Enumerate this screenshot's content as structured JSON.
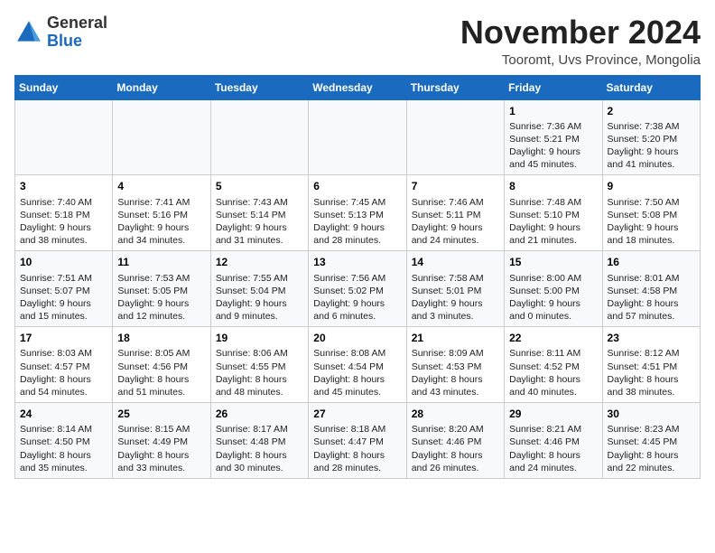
{
  "logo": {
    "text_general": "General",
    "text_blue": "Blue"
  },
  "header": {
    "month_title": "November 2024",
    "location": "Tooromt, Uvs Province, Mongolia"
  },
  "columns": [
    "Sunday",
    "Monday",
    "Tuesday",
    "Wednesday",
    "Thursday",
    "Friday",
    "Saturday"
  ],
  "weeks": [
    [
      {
        "day": "",
        "sunrise": "",
        "sunset": "",
        "daylight": ""
      },
      {
        "day": "",
        "sunrise": "",
        "sunset": "",
        "daylight": ""
      },
      {
        "day": "",
        "sunrise": "",
        "sunset": "",
        "daylight": ""
      },
      {
        "day": "",
        "sunrise": "",
        "sunset": "",
        "daylight": ""
      },
      {
        "day": "",
        "sunrise": "",
        "sunset": "",
        "daylight": ""
      },
      {
        "day": "1",
        "sunrise": "Sunrise: 7:36 AM",
        "sunset": "Sunset: 5:21 PM",
        "daylight": "Daylight: 9 hours and 45 minutes."
      },
      {
        "day": "2",
        "sunrise": "Sunrise: 7:38 AM",
        "sunset": "Sunset: 5:20 PM",
        "daylight": "Daylight: 9 hours and 41 minutes."
      }
    ],
    [
      {
        "day": "3",
        "sunrise": "Sunrise: 7:40 AM",
        "sunset": "Sunset: 5:18 PM",
        "daylight": "Daylight: 9 hours and 38 minutes."
      },
      {
        "day": "4",
        "sunrise": "Sunrise: 7:41 AM",
        "sunset": "Sunset: 5:16 PM",
        "daylight": "Daylight: 9 hours and 34 minutes."
      },
      {
        "day": "5",
        "sunrise": "Sunrise: 7:43 AM",
        "sunset": "Sunset: 5:14 PM",
        "daylight": "Daylight: 9 hours and 31 minutes."
      },
      {
        "day": "6",
        "sunrise": "Sunrise: 7:45 AM",
        "sunset": "Sunset: 5:13 PM",
        "daylight": "Daylight: 9 hours and 28 minutes."
      },
      {
        "day": "7",
        "sunrise": "Sunrise: 7:46 AM",
        "sunset": "Sunset: 5:11 PM",
        "daylight": "Daylight: 9 hours and 24 minutes."
      },
      {
        "day": "8",
        "sunrise": "Sunrise: 7:48 AM",
        "sunset": "Sunset: 5:10 PM",
        "daylight": "Daylight: 9 hours and 21 minutes."
      },
      {
        "day": "9",
        "sunrise": "Sunrise: 7:50 AM",
        "sunset": "Sunset: 5:08 PM",
        "daylight": "Daylight: 9 hours and 18 minutes."
      }
    ],
    [
      {
        "day": "10",
        "sunrise": "Sunrise: 7:51 AM",
        "sunset": "Sunset: 5:07 PM",
        "daylight": "Daylight: 9 hours and 15 minutes."
      },
      {
        "day": "11",
        "sunrise": "Sunrise: 7:53 AM",
        "sunset": "Sunset: 5:05 PM",
        "daylight": "Daylight: 9 hours and 12 minutes."
      },
      {
        "day": "12",
        "sunrise": "Sunrise: 7:55 AM",
        "sunset": "Sunset: 5:04 PM",
        "daylight": "Daylight: 9 hours and 9 minutes."
      },
      {
        "day": "13",
        "sunrise": "Sunrise: 7:56 AM",
        "sunset": "Sunset: 5:02 PM",
        "daylight": "Daylight: 9 hours and 6 minutes."
      },
      {
        "day": "14",
        "sunrise": "Sunrise: 7:58 AM",
        "sunset": "Sunset: 5:01 PM",
        "daylight": "Daylight: 9 hours and 3 minutes."
      },
      {
        "day": "15",
        "sunrise": "Sunrise: 8:00 AM",
        "sunset": "Sunset: 5:00 PM",
        "daylight": "Daylight: 9 hours and 0 minutes."
      },
      {
        "day": "16",
        "sunrise": "Sunrise: 8:01 AM",
        "sunset": "Sunset: 4:58 PM",
        "daylight": "Daylight: 8 hours and 57 minutes."
      }
    ],
    [
      {
        "day": "17",
        "sunrise": "Sunrise: 8:03 AM",
        "sunset": "Sunset: 4:57 PM",
        "daylight": "Daylight: 8 hours and 54 minutes."
      },
      {
        "day": "18",
        "sunrise": "Sunrise: 8:05 AM",
        "sunset": "Sunset: 4:56 PM",
        "daylight": "Daylight: 8 hours and 51 minutes."
      },
      {
        "day": "19",
        "sunrise": "Sunrise: 8:06 AM",
        "sunset": "Sunset: 4:55 PM",
        "daylight": "Daylight: 8 hours and 48 minutes."
      },
      {
        "day": "20",
        "sunrise": "Sunrise: 8:08 AM",
        "sunset": "Sunset: 4:54 PM",
        "daylight": "Daylight: 8 hours and 45 minutes."
      },
      {
        "day": "21",
        "sunrise": "Sunrise: 8:09 AM",
        "sunset": "Sunset: 4:53 PM",
        "daylight": "Daylight: 8 hours and 43 minutes."
      },
      {
        "day": "22",
        "sunrise": "Sunrise: 8:11 AM",
        "sunset": "Sunset: 4:52 PM",
        "daylight": "Daylight: 8 hours and 40 minutes."
      },
      {
        "day": "23",
        "sunrise": "Sunrise: 8:12 AM",
        "sunset": "Sunset: 4:51 PM",
        "daylight": "Daylight: 8 hours and 38 minutes."
      }
    ],
    [
      {
        "day": "24",
        "sunrise": "Sunrise: 8:14 AM",
        "sunset": "Sunset: 4:50 PM",
        "daylight": "Daylight: 8 hours and 35 minutes."
      },
      {
        "day": "25",
        "sunrise": "Sunrise: 8:15 AM",
        "sunset": "Sunset: 4:49 PM",
        "daylight": "Daylight: 8 hours and 33 minutes."
      },
      {
        "day": "26",
        "sunrise": "Sunrise: 8:17 AM",
        "sunset": "Sunset: 4:48 PM",
        "daylight": "Daylight: 8 hours and 30 minutes."
      },
      {
        "day": "27",
        "sunrise": "Sunrise: 8:18 AM",
        "sunset": "Sunset: 4:47 PM",
        "daylight": "Daylight: 8 hours and 28 minutes."
      },
      {
        "day": "28",
        "sunrise": "Sunrise: 8:20 AM",
        "sunset": "Sunset: 4:46 PM",
        "daylight": "Daylight: 8 hours and 26 minutes."
      },
      {
        "day": "29",
        "sunrise": "Sunrise: 8:21 AM",
        "sunset": "Sunset: 4:46 PM",
        "daylight": "Daylight: 8 hours and 24 minutes."
      },
      {
        "day": "30",
        "sunrise": "Sunrise: 8:23 AM",
        "sunset": "Sunset: 4:45 PM",
        "daylight": "Daylight: 8 hours and 22 minutes."
      }
    ]
  ]
}
